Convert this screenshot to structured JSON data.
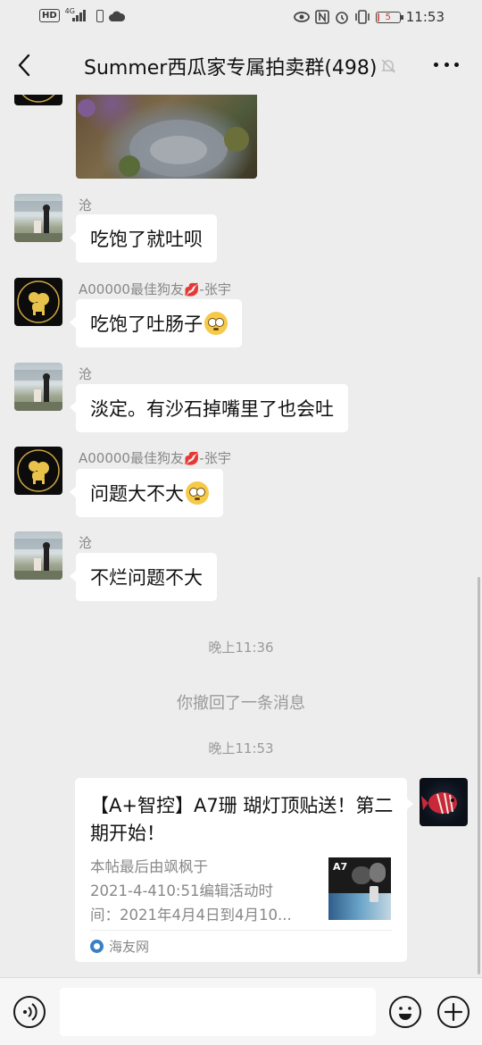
{
  "status_bar": {
    "network_chip": "HD",
    "network_type": "4G",
    "battery_level": "5",
    "battery_fraction": 0.05,
    "time": "11:53",
    "icons": [
      "hd-icon",
      "signal-icon",
      "battery-saver-icon",
      "cloud-icon",
      "eye-icon",
      "nfc-icon",
      "alarm-icon",
      "vibrate-icon",
      "battery-icon"
    ]
  },
  "header": {
    "title": "Summer西瓜家专属拍卖群(498)",
    "back_icon": "chevron-left-icon",
    "mute_icon": "bell-off-icon",
    "more_icon": "more-dots-icon"
  },
  "messages": [
    {
      "type": "image",
      "sender": "",
      "avatar": "dog-avatar"
    },
    {
      "type": "text",
      "sender": "沧",
      "text": "吃饱了就吐呗",
      "avatar": "cang-avatar"
    },
    {
      "type": "text",
      "sender": "A00000最佳狗友💋-张宇",
      "sender_name": "A00000最佳狗友",
      "sender_suffix": "-张宇",
      "text": "吃饱了吐肠子",
      "emoji": "flushed-face",
      "avatar": "dog-avatar"
    },
    {
      "type": "text",
      "sender": "沧",
      "text": "淡定。有沙石掉嘴里了也会吐",
      "avatar": "cang-avatar"
    },
    {
      "type": "text",
      "sender": "A00000最佳狗友💋-张宇",
      "sender_name": "A00000最佳狗友",
      "sender_suffix": "-张宇",
      "text": "问题大不大",
      "emoji": "flushed-face",
      "avatar": "dog-avatar"
    },
    {
      "type": "text",
      "sender": "沧",
      "text": "不烂问题不大",
      "avatar": "cang-avatar"
    }
  ],
  "system": {
    "time1": "晚上11:36",
    "recall": "你撤回了一条消息",
    "time2": "晚上11:53"
  },
  "card": {
    "title": "【A+智控】A7珊 瑚灯顶贴送！第二期开始！",
    "description": "本帖最后由飒枫于\n2021-4-410:51编辑活动时\n间：2021年4月4日到4月10...",
    "thumb_label": "A7",
    "source": "海友网",
    "avatar": "fish-avatar"
  },
  "input_bar": {
    "voice_icon": "voice-icon",
    "emoji_icon": "emoji-icon",
    "plus_icon": "plus-icon",
    "placeholder": ""
  }
}
